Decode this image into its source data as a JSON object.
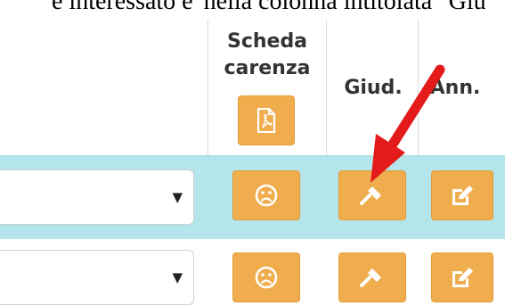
{
  "top_text": "e interessato e' nella colonna intitolata \"Giu",
  "header": {
    "col1_line1": "Scheda",
    "col1_line2": "carenza",
    "col2": "Giud.",
    "col3": "Ann."
  },
  "rows": [
    {
      "select_caret": "▼",
      "highlighted": true
    },
    {
      "select_caret": "▼",
      "highlighted": false
    }
  ],
  "icons": {
    "header_button": "pdf-file-icon",
    "col1": "frown-icon",
    "col2": "gavel-icon",
    "col3": "edit-icon",
    "annotation": "red-arrow"
  },
  "colors": {
    "button_orange": "#f0ad4e",
    "highlight_row": "#b3e5ea",
    "arrow_red": "#e31b1b"
  }
}
